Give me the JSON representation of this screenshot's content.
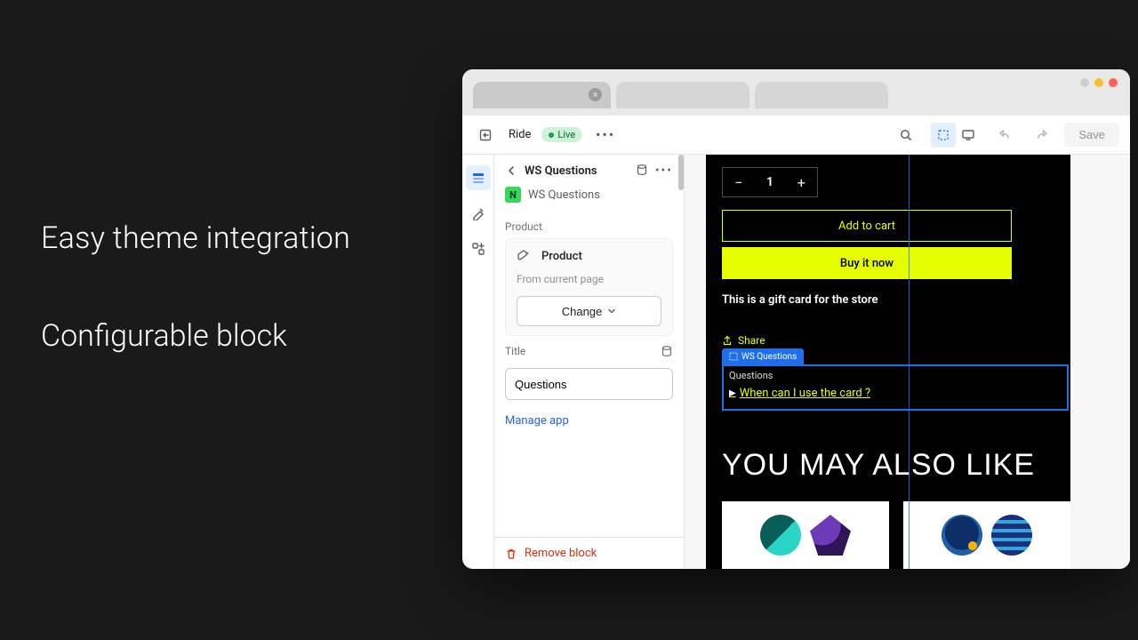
{
  "marketing": {
    "line1": "Easy theme integration",
    "line2": "Configurable block"
  },
  "toolbar": {
    "theme": "Ride",
    "live": "Live",
    "save": "Save"
  },
  "panel": {
    "title": "WS Questions",
    "app": "WS Questions",
    "section_product": "Product",
    "product_name": "Product",
    "product_sub": "From current page",
    "change": "Change",
    "section_title": "Title",
    "title_value": "Questions",
    "manage": "Manage app",
    "remove": "Remove block"
  },
  "preview": {
    "qty": "1",
    "add_to_cart": "Add to cart",
    "buy_now": "Buy it now",
    "gift_text": "This is a gift card for the store",
    "share": "Share",
    "ws_badge": "WS Questions",
    "questions_header": "Questions",
    "question_1": "When can I use the card ?",
    "ymal": "YOU MAY ALSO LIKE"
  }
}
